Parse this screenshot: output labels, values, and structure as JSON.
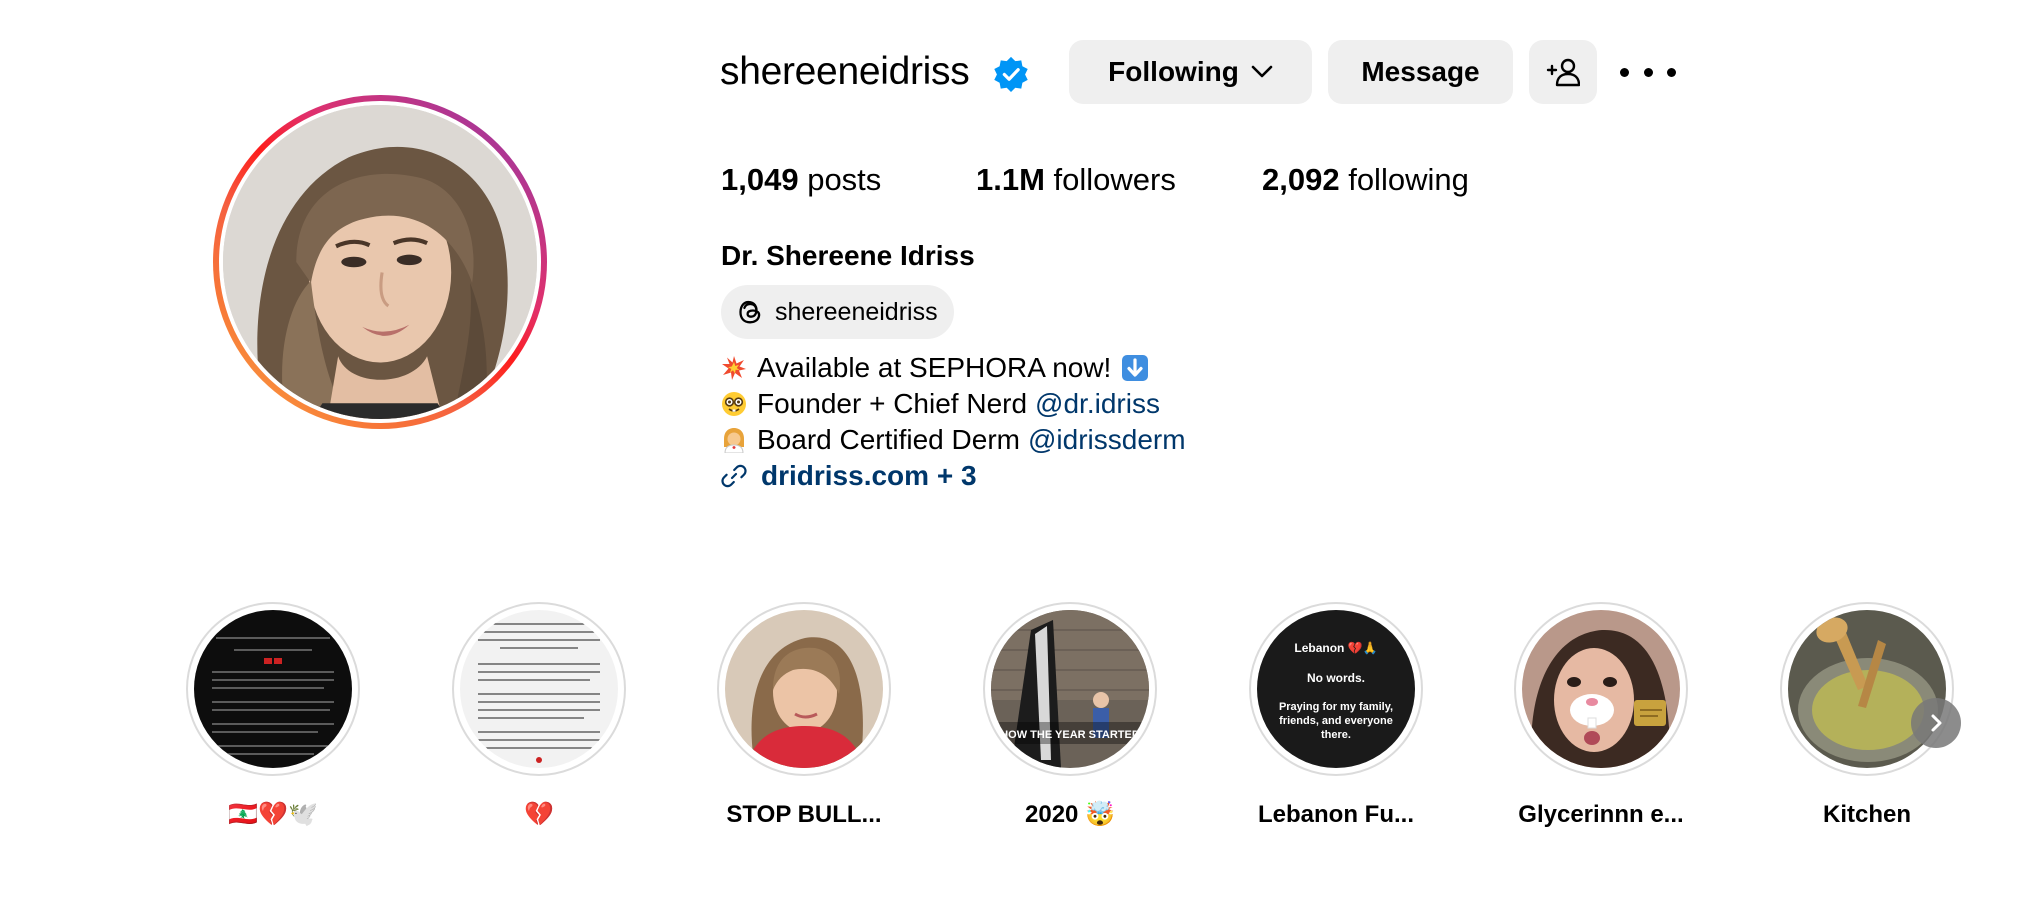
{
  "profile": {
    "username": "shereeneidriss",
    "verified": true,
    "full_name": "Dr. Shereene Idriss",
    "threads_handle": "shereeneidriss"
  },
  "actions": {
    "following_label": "Following",
    "message_label": "Message",
    "add_user_icon": "person-add-icon",
    "more_icon": "ellipsis-icon"
  },
  "stats": {
    "posts_count": "1,049",
    "posts_label": "posts",
    "followers_count": "1.1M",
    "followers_label": "followers",
    "following_count": "2,092",
    "following_label": "following"
  },
  "bio": {
    "line1_text": "Available at SEPHORA now!",
    "line2_text": "Founder + Chief Nerd ",
    "line2_mention": "@dr.idriss",
    "line3_text": "Board Certified Derm ",
    "line3_mention": "@idrissderm",
    "website": "dridriss.com + 3"
  },
  "highlights": [
    {
      "label": "🇱🇧💔🕊️",
      "cover": "black-text-slide"
    },
    {
      "label": "💔",
      "cover": "white-text-slide"
    },
    {
      "label": "STOP BULL...",
      "cover": "portrait-red-top"
    },
    {
      "label": "2020 🤯",
      "cover": "slide-with-child",
      "overlay_text": "HOW THE YEAR STARTED"
    },
    {
      "label": "Lebanon Fu...",
      "cover": "black-card",
      "card_title": "Lebanon 💔🙏",
      "card_line1": "No words.",
      "card_line2": "Praying for my family, friends, and everyone there."
    },
    {
      "label": "Glycerinnn e...",
      "cover": "bunny-filter-selfie"
    },
    {
      "label": "Kitchen",
      "cover": "wooden-spoon-bowl"
    }
  ],
  "colors": {
    "link": "#00376b",
    "button_bg": "#efefef",
    "verified_blue": "#0095f6",
    "ring_border": "#dbdbdb"
  }
}
